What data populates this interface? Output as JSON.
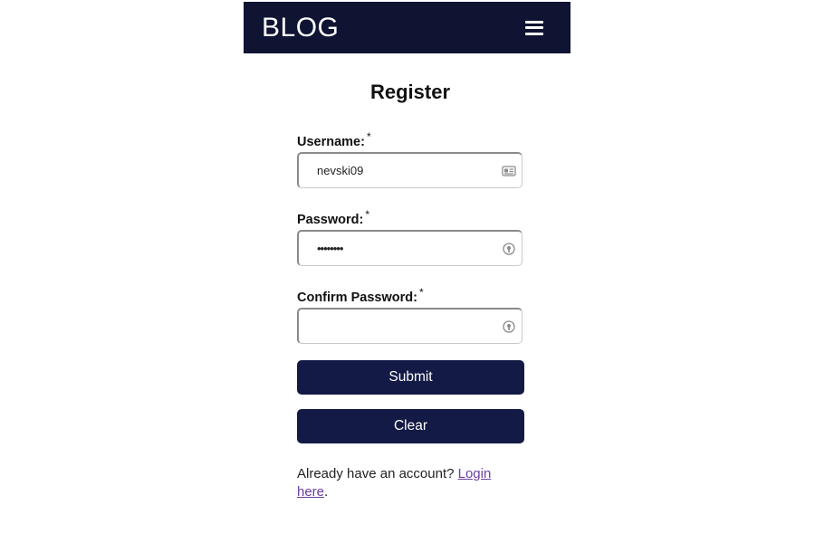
{
  "navbar": {
    "brand": "BLOG",
    "menu_icon": "hamburger-menu-icon"
  },
  "page": {
    "title": "Register"
  },
  "form": {
    "username": {
      "label": "Username:",
      "required_mark": "*",
      "value": "nevski09",
      "icon": "contact-card-icon"
    },
    "password": {
      "label": "Password:",
      "required_mark": "*",
      "value": "••••••••",
      "icon": "password-key-icon"
    },
    "confirm_password": {
      "label": "Confirm Password:",
      "required_mark": "*",
      "value": "",
      "icon": "password-key-icon"
    },
    "submit_label": "Submit",
    "clear_label": "Clear"
  },
  "footer": {
    "prompt": "Already have an account? ",
    "link_text": "Login here",
    "trailing": "."
  },
  "colors": {
    "navbar_bg": "#0f1432",
    "button_bg": "#131a45",
    "link": "#6a3ea1"
  }
}
